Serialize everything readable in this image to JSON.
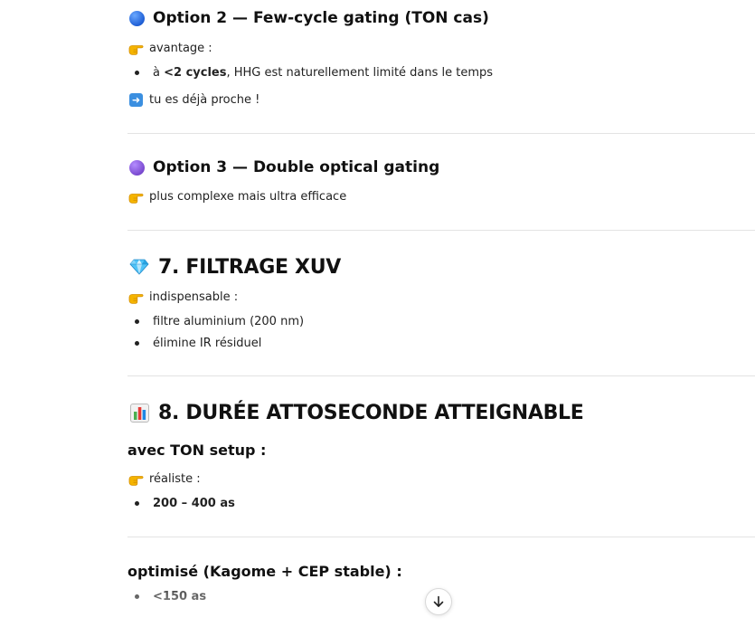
{
  "section_option2": {
    "title": "Option 2 — Few-cycle gating (TON cas)",
    "icon": "blue-circle-icon",
    "intro": "avantage :",
    "bullet_prefix": "à ",
    "bullet_bold": "<2 cycles",
    "bullet_rest": ", HHG est naturellement limité dans le temps",
    "note": "tu es déjà proche !"
  },
  "section_option3": {
    "title": "Option 3 — Double optical gating",
    "icon": "purple-circle-icon",
    "intro": "plus complexe mais ultra efficace"
  },
  "section_filtrage": {
    "title": "7. FILTRAGE XUV",
    "icon": "gem-icon",
    "intro": "indispensable :",
    "bullets": [
      "filtre aluminium (200 nm)",
      "élimine IR résiduel"
    ]
  },
  "section_duree": {
    "title": "8. DURÉE ATTOSECONDE ATTEIGNABLE",
    "icon": "bar-chart-icon",
    "sub1_title": "avec TON setup :",
    "sub1_intro": "réaliste :",
    "sub1_bullet": "200 – 400 as",
    "sub2_title": "optimisé (Kagome + CEP stable) :",
    "sub2_bullet": "<150 as"
  },
  "colors": {
    "blue_circle": "#1f5fd6",
    "purple_circle": "#7a4ad0",
    "divider": "#e3e3e3",
    "arrow_box": "#3b8fe0"
  },
  "scroll_button": {
    "icon": "arrow-down-icon"
  }
}
